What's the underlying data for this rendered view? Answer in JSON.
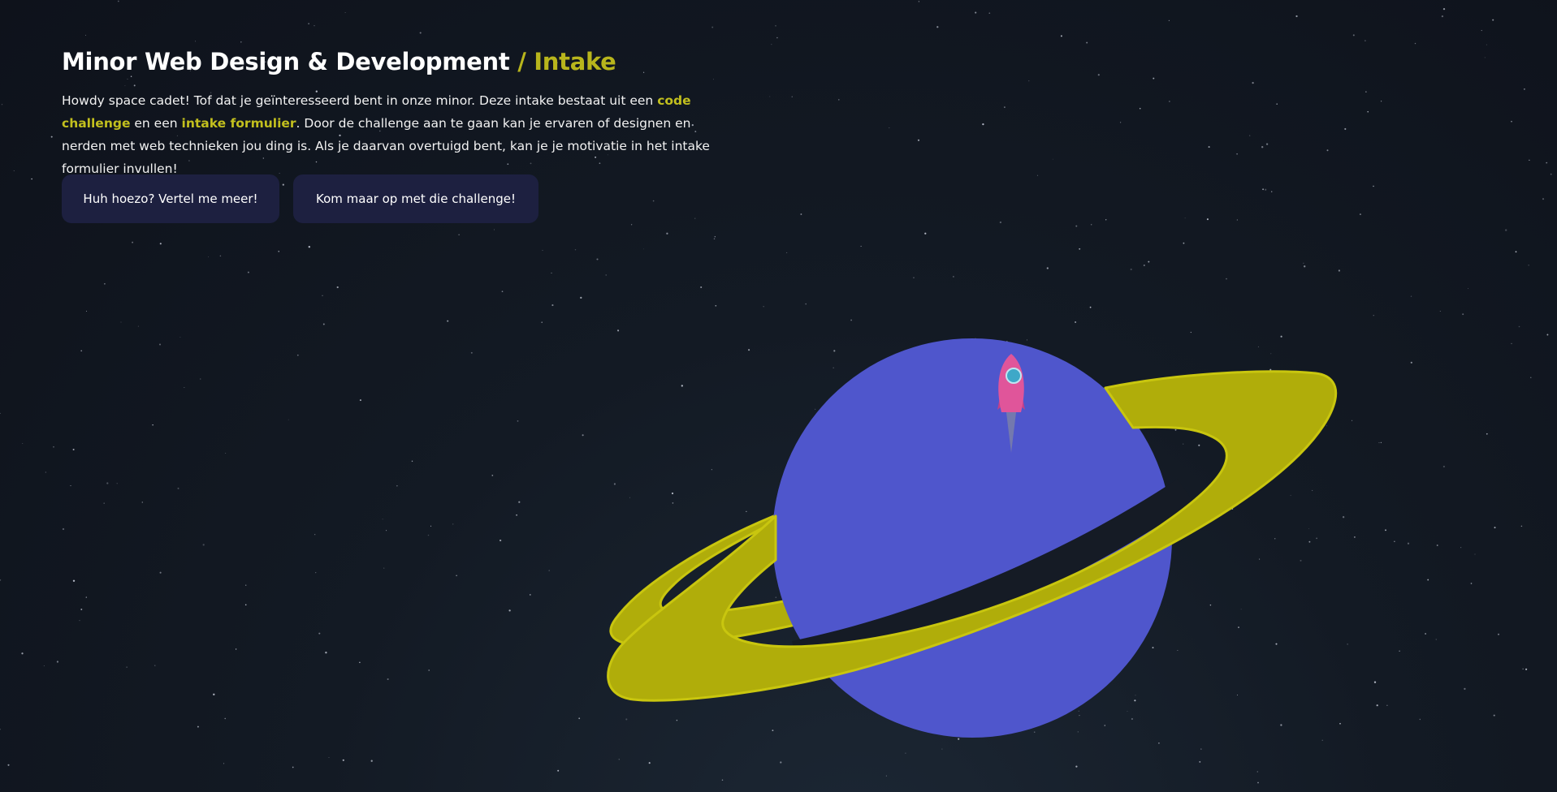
{
  "header": {
    "title_main": "Minor Web Design & Development",
    "title_accent": "/ Intake"
  },
  "intro": {
    "part1": "Howdy space cadet! Tof dat je geïnteresseerd bent in onze minor. Deze intake bestaat uit een ",
    "highlight1": "code challenge",
    "part2": " en een ",
    "highlight2": "intake formulier",
    "part3": ". Door de challenge aan te gaan kan je ervaren of designen en nerden met web technieken jou ding is. Als je daarvan overtuigd bent, kan je je motivatie in het intake formulier invullen!"
  },
  "buttons": {
    "more_label": "Huh hoezo? Vertel me meer!",
    "challenge_label": "Kom maar op met die challenge!"
  },
  "colors": {
    "accent": "#b8b51c",
    "planet": "#4f56cc",
    "ring": "#b0ad0a",
    "rocket": "#e0559a",
    "button_bg": "#1d2040"
  },
  "illustration": {
    "planet": "planet-icon",
    "rocket": "rocket-icon"
  }
}
